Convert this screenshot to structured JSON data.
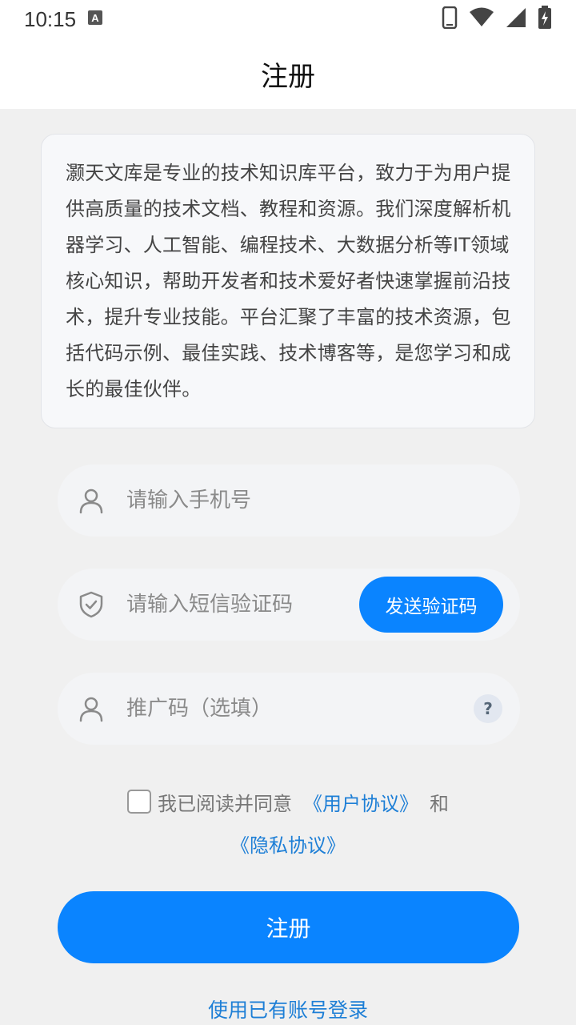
{
  "status_bar": {
    "time": "10:15",
    "notification_icon": "a-keyboard-icon",
    "icons": [
      "phone-icon",
      "wifi-icon",
      "signal-icon",
      "battery-charging-icon"
    ]
  },
  "header": {
    "title": "注册"
  },
  "intro": {
    "text": "灏天文库是专业的技术知识库平台，致力于为用户提供高质量的技术文档、教程和资源。我们深度解析机器学习、人工智能、编程技术、大数据分析等IT领域核心知识，帮助开发者和技术爱好者快速掌握前沿技术，提升专业技能。平台汇聚了丰富的技术资源，包括代码示例、最佳实践、技术博客等，是您学习和成长的最佳伙伴。"
  },
  "form": {
    "phone_placeholder": "请输入手机号",
    "sms_placeholder": "请输入短信验证码",
    "send_code_label": "发送验证码",
    "promo_placeholder": "推广码（选填）",
    "help_label": "?"
  },
  "agreement": {
    "prefix": "我已阅读并同意",
    "user_agreement": "《用户协议》",
    "and": "和",
    "privacy_policy": "《隐私协议》"
  },
  "actions": {
    "register_label": "注册",
    "login_link": "使用已有账号登录"
  },
  "colors": {
    "accent": "#0a84ff",
    "link": "#1e7fd6",
    "background": "#f0f0f0"
  }
}
